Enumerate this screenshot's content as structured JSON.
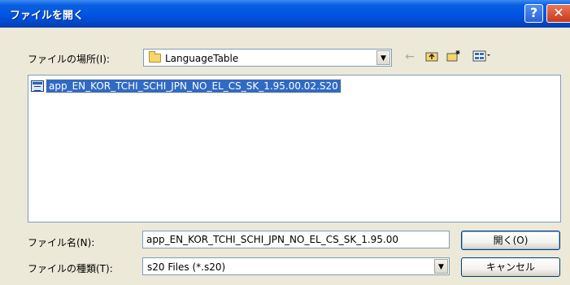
{
  "window": {
    "title": "ファイルを開く",
    "help_glyph": "?",
    "close_glyph": "✕"
  },
  "look_in": {
    "label": "ファイルの場所(I):",
    "value": "LanguageTable",
    "icon": "folder-icon"
  },
  "toolbar": {
    "back_icon": "←",
    "up_icon": "up-folder-icon",
    "new_folder_icon": "new-folder-icon",
    "views_icon": "views-menu-icon"
  },
  "files": [
    {
      "name": "app_EN_KOR_TCHI_SCHI_JPN_NO_EL_CS_SK_1.95.00.02.S20",
      "selected": true
    }
  ],
  "file_name": {
    "label": "ファイル名(N):",
    "value": "app_EN_KOR_TCHI_SCHI_JPN_NO_EL_CS_SK_1.95.00"
  },
  "file_type": {
    "label": "ファイルの種類(T):",
    "value": "s20 Files (*.s20)"
  },
  "buttons": {
    "open": "開く(O)",
    "cancel": "キャンセル"
  },
  "colors": {
    "title_bar": "#0054e3",
    "selection": "#316ac5",
    "dialog_bg": "#ece9d8"
  }
}
